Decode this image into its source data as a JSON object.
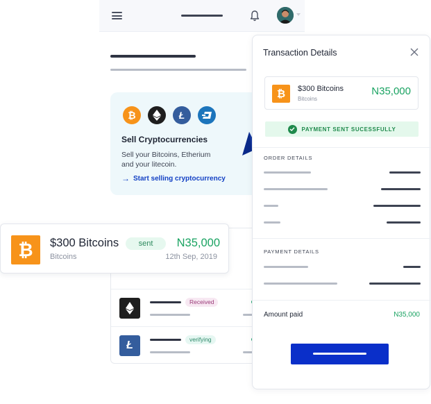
{
  "sell_card": {
    "title": "Sell Cryptocurrencies",
    "description": "Sell your Bitcoins, Etherium and your litecoin.",
    "link": "Start selling cryptocurrency",
    "coins": [
      "bitcoin-icon",
      "ethereum-icon",
      "litecoin-icon",
      "dash-icon"
    ]
  },
  "list": {
    "rows": [
      {
        "icon": "ethereum-icon",
        "badge": "Received"
      },
      {
        "icon": "litecoin-icon",
        "badge": "verifying"
      }
    ]
  },
  "float_card": {
    "title": "$300 Bitcoins",
    "subtitle": "Bitcoins",
    "status": "sent",
    "amount": "N35,000",
    "date": "12th Sep, 2019"
  },
  "panel": {
    "title": "Transaction Details",
    "transaction": {
      "title": "$300 Bitcoins",
      "subtitle": "Bitcoins",
      "amount": "N35,000"
    },
    "success_message": "PAYMENT SENT SUCESSFULLY",
    "order_details_label": "ORDER DETAILS",
    "payment_details_label": "PAYMENT DETAILS",
    "amount_paid_label": "Amount paid",
    "amount_paid_value": "N35,000"
  },
  "colors": {
    "accent_blue": "#0a2fc9",
    "success_green": "#1aa362",
    "bitcoin_orange": "#f7931a"
  }
}
